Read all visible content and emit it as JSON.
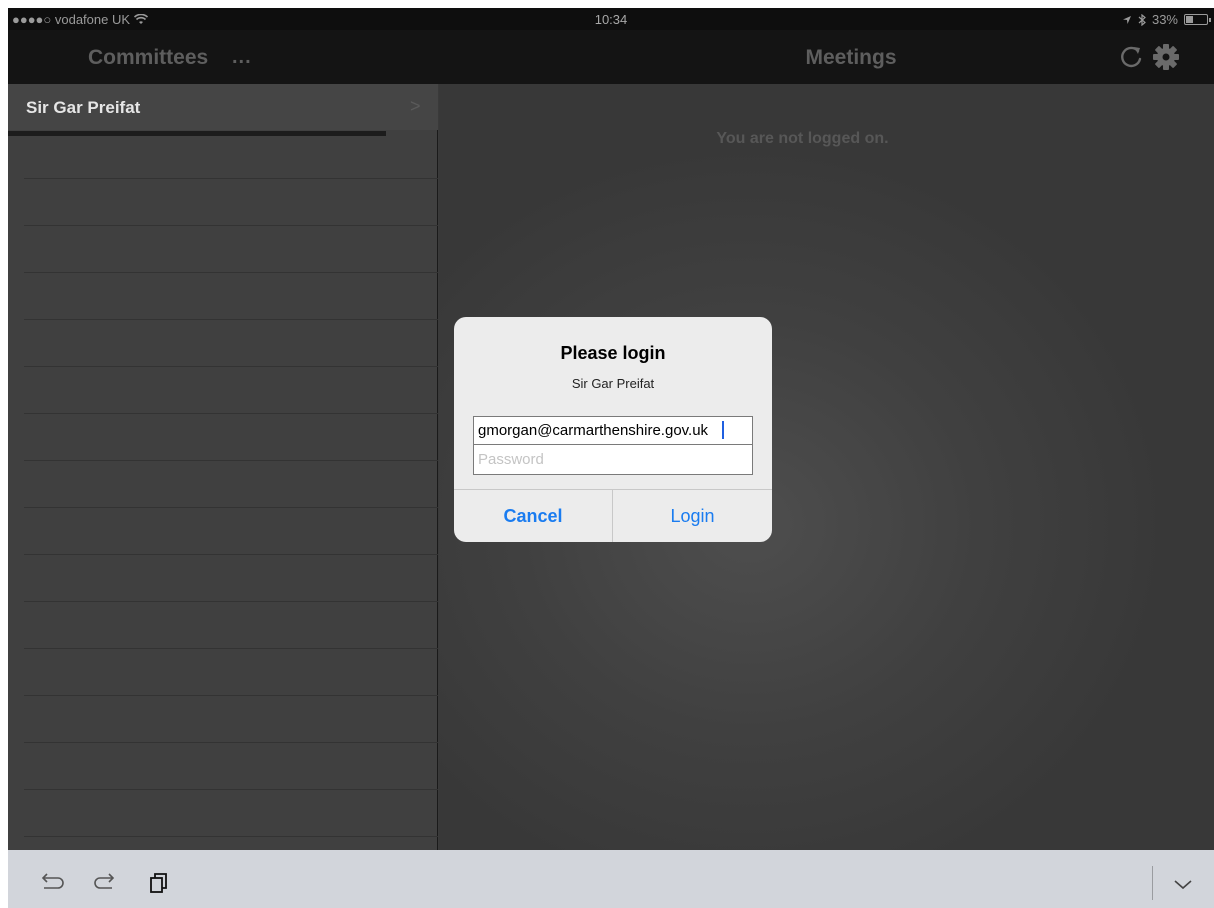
{
  "status_bar": {
    "carrier": "●●●●○ vodafone UK",
    "time": "10:34",
    "battery_percent": "33%",
    "battery_level": 0.33
  },
  "nav": {
    "left_title": "Committees",
    "left_more": "...",
    "right_title": "Meetings"
  },
  "master": {
    "items": [
      {
        "label": "Sir Gar Preifat"
      }
    ],
    "chevron": ">"
  },
  "detail": {
    "message": "You are not logged on."
  },
  "login_alert": {
    "title": "Please login",
    "message": "Sir Gar Preifat",
    "email_value": "gmorgan@carmarthenshire.gov.uk",
    "password_placeholder": "Password",
    "cancel_label": "Cancel",
    "login_label": "Login"
  },
  "icons": {
    "accent": "#1a7cf0"
  }
}
